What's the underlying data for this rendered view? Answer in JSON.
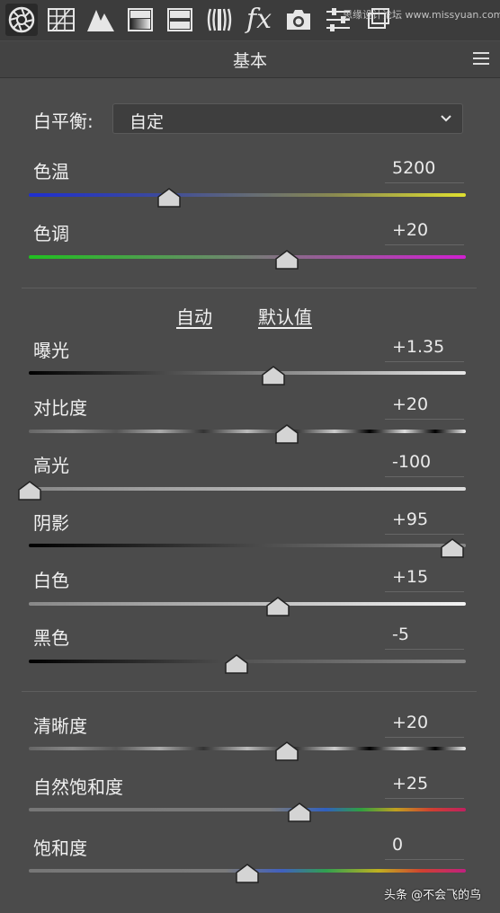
{
  "toolbar": {
    "icons": [
      "aperture-icon",
      "grid-icon",
      "mountains-icon",
      "gradient-panel-icon",
      "split-panel-icon",
      "lens-profile-icon",
      "fx-icon",
      "camera-icon",
      "sliders-icon",
      "layers-icon"
    ],
    "fx_label": "fx",
    "watermark": "思缘设计论坛 www.missyuan.com"
  },
  "panel": {
    "title": "基本"
  },
  "white_balance": {
    "label": "白平衡:",
    "value": "自定"
  },
  "wb_sliders": [
    {
      "label": "色温",
      "value": "5200",
      "position": 0.32
    },
    {
      "label": "色调",
      "value": "+20",
      "position": 0.59
    }
  ],
  "tone_links": {
    "auto": "自动",
    "default": "默认值"
  },
  "tone_sliders": [
    {
      "label": "曝光",
      "value": "+1.35",
      "position": 0.56
    },
    {
      "label": "对比度",
      "value": "+20",
      "position": 0.59
    },
    {
      "label": "高光",
      "value": "-100",
      "position": 0.0
    },
    {
      "label": "阴影",
      "value": "+95",
      "position": 0.97
    },
    {
      "label": "白色",
      "value": "+15",
      "position": 0.57
    },
    {
      "label": "黑色",
      "value": "-5",
      "position": 0.475
    }
  ],
  "presence_sliders": [
    {
      "label": "清晰度",
      "value": "+20",
      "position": 0.59
    },
    {
      "label": "自然饱和度",
      "value": "+25",
      "position": 0.62
    },
    {
      "label": "饱和度",
      "value": "0",
      "position": 0.5
    }
  ],
  "footer": {
    "watermark": "头条 @不会飞的鸟"
  }
}
